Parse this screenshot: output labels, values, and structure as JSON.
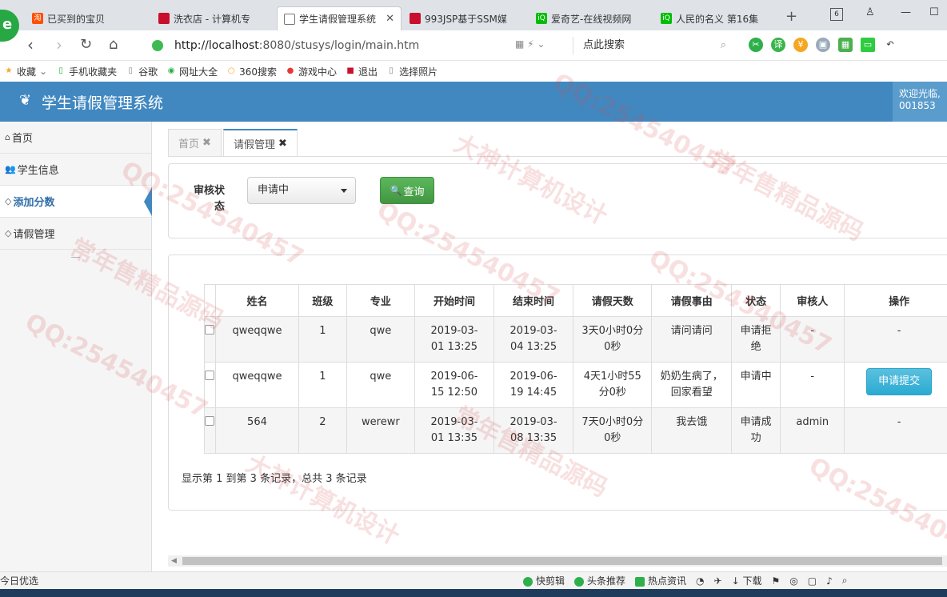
{
  "browser": {
    "tabs": [
      {
        "label": "已买到的宝贝",
        "icon": "taobao-icon",
        "color": "#ff5000"
      },
      {
        "label": "洗衣店 - 计算机专",
        "icon": "red-favicon-icon",
        "color": "#c8102e"
      },
      {
        "label": "学生请假管理系统",
        "icon": "page-favicon-icon",
        "color": "#777777",
        "active": true
      },
      {
        "label": "993JSP基于SSM媒",
        "icon": "red-favicon-icon",
        "color": "#c8102e"
      },
      {
        "label": "爱奇艺-在线视频网",
        "icon": "iqiyi-icon",
        "color": "#00be06"
      },
      {
        "label": "人民的名义 第16集",
        "icon": "iqiyi-icon",
        "color": "#00be06"
      }
    ],
    "tab_count": "6",
    "url_host": "http://localhost",
    "url_rest": ":8080/stusys/login/main.htm",
    "search_placeholder": "点此搜索",
    "bookmarks": [
      "收藏",
      "手机收藏夹",
      "谷歌",
      "网址大全",
      "360搜索",
      "游戏中心",
      "退出",
      "选择照片"
    ]
  },
  "header": {
    "title": "学生请假管理系统",
    "welcome": "欢迎光临,",
    "user_id": "001853",
    "bg_color": "#4188c1"
  },
  "sidebar": {
    "items": [
      {
        "label": "首页",
        "icon": "home-icon"
      },
      {
        "label": "学生信息",
        "icon": "users-icon"
      },
      {
        "label": "添加分数",
        "icon": "tag-icon",
        "active": true
      },
      {
        "label": "请假管理",
        "icon": "tag-icon"
      }
    ],
    "collapse_label": "—"
  },
  "content_tabs": {
    "home": "首页",
    "leave": "请假管理"
  },
  "filter": {
    "label": "审核状态",
    "selected": "申请中",
    "query_label": "查询"
  },
  "table": {
    "headers": [
      "姓名",
      "班级",
      "专业",
      "开始时间",
      "结束时间",
      "请假天数",
      "请假事由",
      "状态",
      "审核人",
      "操作"
    ],
    "rows": [
      {
        "name": "qweqqwe",
        "class": "1",
        "major": "qwe",
        "start": "2019-03-01 13:25",
        "end": "2019-03-04 13:25",
        "days": "3天0小时0分0秒",
        "reason": "请问请问",
        "status": "申请拒绝",
        "reviewer": "-",
        "action": "-"
      },
      {
        "name": "qweqqwe",
        "class": "1",
        "major": "qwe",
        "start": "2019-06-15 12:50",
        "end": "2019-06-19 14:45",
        "days": "4天1小时55分0秒",
        "reason": "奶奶生病了，回家看望",
        "status": "申请中",
        "reviewer": "-",
        "action": "申请提交"
      },
      {
        "name": "564",
        "class": "2",
        "major": "werewr",
        "start": "2019-03-01 13:35",
        "end": "2019-03-08 13:35",
        "days": "7天0小时0分0秒",
        "reason": "我去饿",
        "status": "申请成功",
        "reviewer": "admin",
        "action": "-"
      }
    ],
    "page_info": "显示第 1 到第 3 条记录，总共 3 条记录"
  },
  "statusbar": {
    "left": "今日优选",
    "items": [
      "快剪辑",
      "头条推荐",
      "热点资讯",
      "下载"
    ]
  },
  "watermarks": [
    "QQ:254540457",
    "常年售精品源码",
    "大神计算机设计"
  ]
}
